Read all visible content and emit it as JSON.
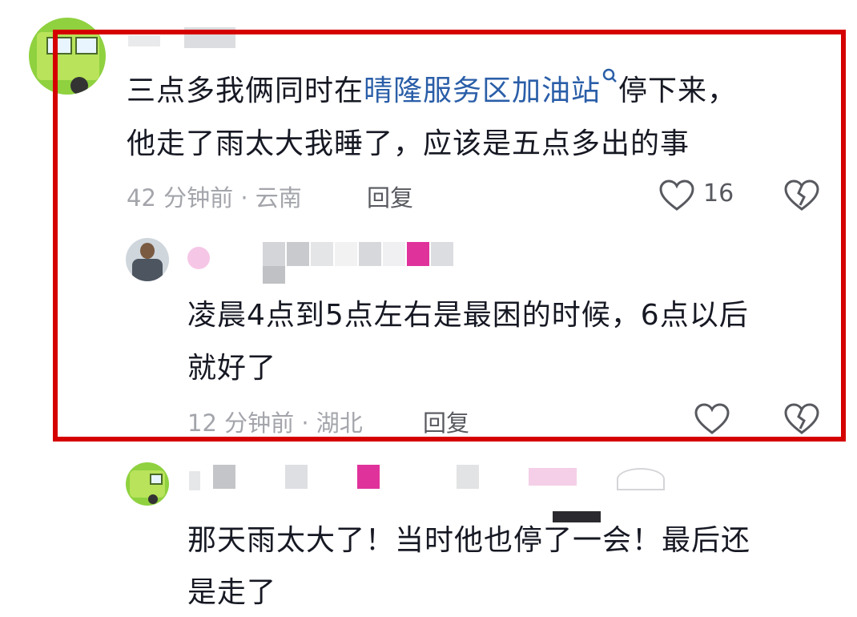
{
  "comments": [
    {
      "text_line1_a": "三点多我俩同时在",
      "text_link": "晴隆服务区加油站",
      "text_line1_b": "停下来，",
      "text_line2": "他走了雨太大我睡了，应该是五点多出的事",
      "meta": "42 分钟前 · 云南",
      "reply_label": "回复",
      "like_count": "16"
    }
  ],
  "reply": {
    "text_line1": "凌晨4点到5点左右是最困的时候，6点以后",
    "text_line2": "就好了",
    "meta": "12 分钟前 · 湖北",
    "reply_label": "回复"
  },
  "comment2": {
    "text_line1": "那天雨太大了！当时他也停了一会！最后还",
    "text_line2": "是走了"
  },
  "colors": {
    "highlight": "#d50000",
    "link": "#2a5ea8",
    "meta": "#a3a5ab",
    "mosaic_pink": "#e0329b"
  }
}
